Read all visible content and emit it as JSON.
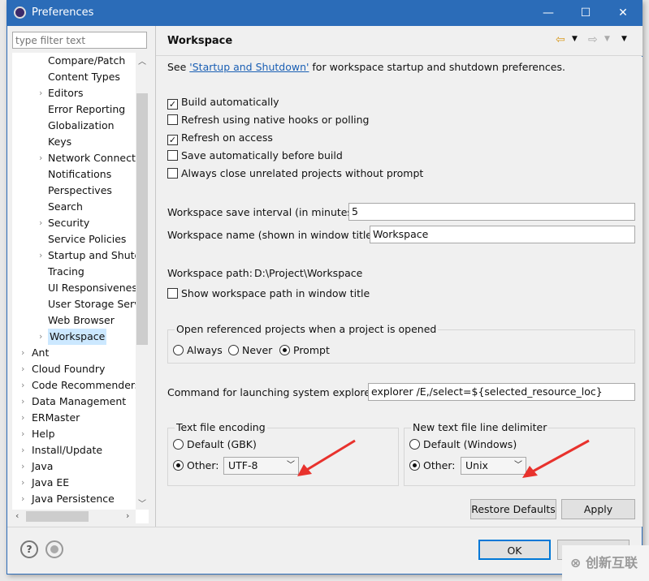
{
  "window": {
    "title": "Preferences"
  },
  "filter": {
    "placeholder": "type filter text"
  },
  "tree": {
    "children": [
      "Compare/Patch",
      "Content Types",
      "Editors",
      "Error Reporting",
      "Globalization",
      "Keys",
      "Network Connectio",
      "Notifications",
      "Perspectives",
      "Search",
      "Security",
      "Service Policies",
      "Startup and Shutd",
      "Tracing",
      "UI Responsiveness",
      "User Storage Serv",
      "Web Browser",
      "Workspace"
    ],
    "expandable_children": [
      "Editors",
      "Network Connectio",
      "Security",
      "Startup and Shutd",
      "Workspace"
    ],
    "top": [
      "Ant",
      "Cloud Foundry",
      "Code Recommenders",
      "Data Management",
      "ERMaster",
      "Help",
      "Install/Update",
      "Java",
      "Java EE",
      "Java Persistence"
    ],
    "selected": "Workspace"
  },
  "page": {
    "title": "Workspace",
    "intro_prefix": "See ",
    "intro_link": "'Startup and Shutdown'",
    "intro_suffix": " for workspace startup and shutdown preferences.",
    "checkboxes": [
      {
        "label": "Build automatically",
        "checked": true
      },
      {
        "label": "Refresh using native hooks or polling",
        "checked": false
      },
      {
        "label": "Refresh on access",
        "checked": true
      },
      {
        "label": "Save automatically before build",
        "checked": false
      },
      {
        "label": "Always close unrelated projects without prompt",
        "checked": false
      }
    ],
    "save_interval_label": "Workspace save interval (in minutes):",
    "save_interval_value": "5",
    "ws_name_label": "Workspace name (shown in window title):",
    "ws_name_value": "Workspace",
    "ws_path_label": "Workspace path:",
    "ws_path_value": "D:\\Project\\Workspace",
    "show_path_label": "Show workspace path in window title",
    "open_ref": {
      "label": "Open referenced projects when a project is opened",
      "options": [
        "Always",
        "Never",
        "Prompt"
      ],
      "selected": "Prompt"
    },
    "explorer_label": "Command for launching system explorer:",
    "explorer_value": "explorer /E,/select=${selected_resource_loc}",
    "encoding": {
      "label": "Text file encoding",
      "default_label": "Default (GBK)",
      "other_label": "Other:",
      "selected": "Other",
      "value": "UTF-8"
    },
    "delimiter": {
      "label": "New text file line delimiter",
      "default_label": "Default (Windows)",
      "other_label": "Other:",
      "selected": "Other",
      "value": "Unix"
    },
    "restore_defaults": "Restore Defaults",
    "apply": "Apply"
  },
  "footer": {
    "ok": "OK",
    "cancel": "Cancel"
  },
  "watermark": "创新互联",
  "colors": {
    "titlebar": "#2b6cb8",
    "selection": "#cce8ff",
    "link": "#1a5fb4",
    "annotation_arrow": "#e8322d"
  }
}
